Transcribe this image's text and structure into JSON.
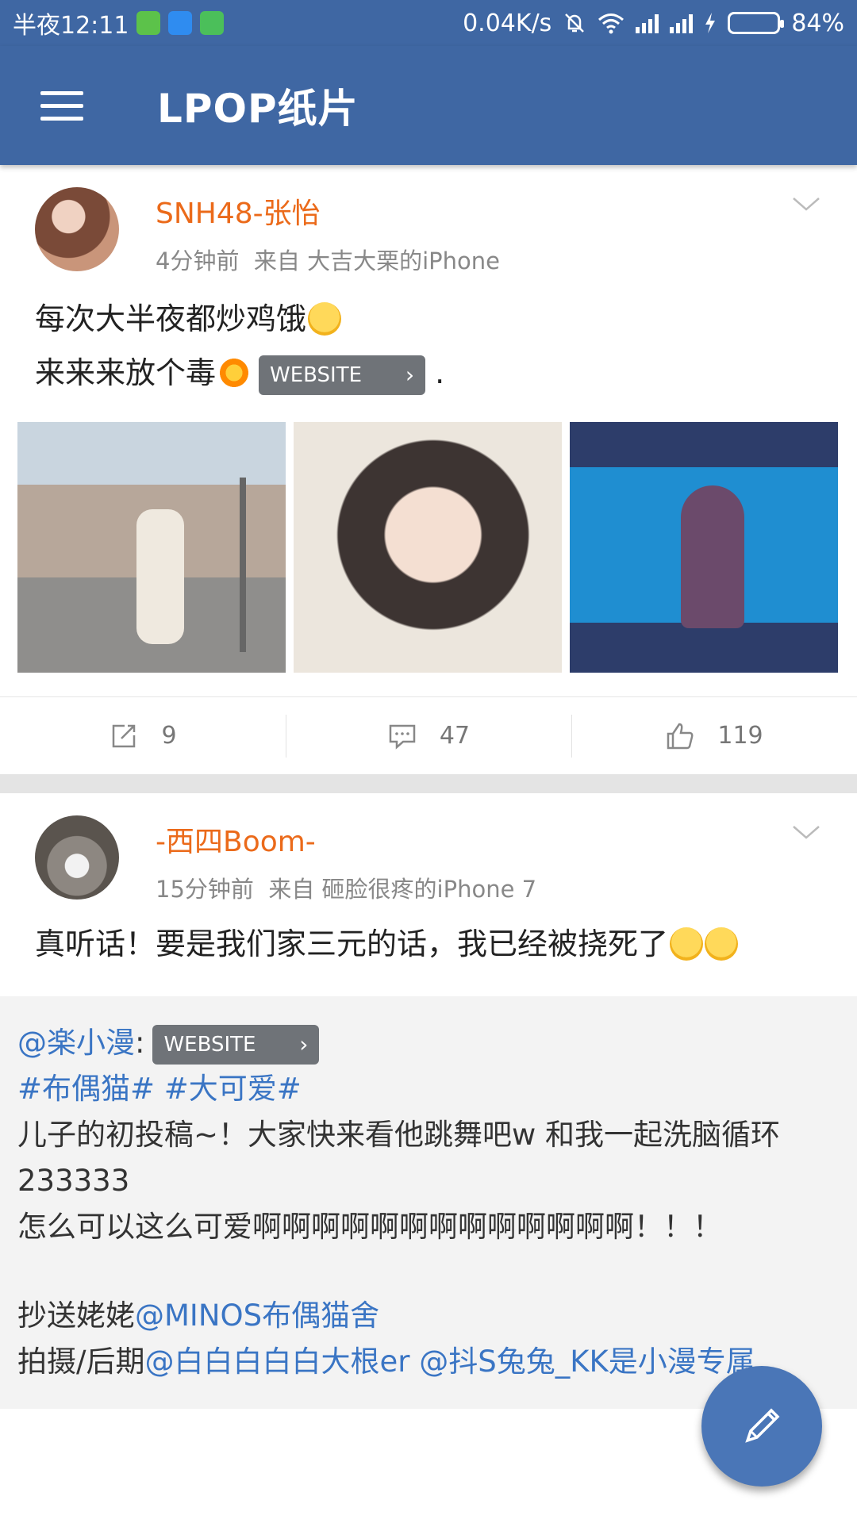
{
  "status_bar": {
    "time": "半夜12:11",
    "net_speed": "0.04K/s",
    "battery": "84%",
    "battery_level": 0.84
  },
  "app_bar": {
    "title": "LPOP纸片",
    "menu_icon": "hamburger-menu-icon"
  },
  "posts": [
    {
      "username": "SNH48-张怡",
      "time_ago": "4分钟前",
      "source": "来自 大吉大栗的iPhone",
      "text_line1": "每次大半夜都炒鸡饿",
      "text_line2": "来来来放个毒",
      "link_label": "WEBSITE",
      "text_tail": ".",
      "images": [
        "photo-1",
        "photo-2",
        "photo-3"
      ],
      "reposts": "9",
      "comments": "47",
      "likes": "119"
    },
    {
      "username": "-西四Boom-",
      "time_ago": "15分钟前",
      "source": "来自 砸脸很疼的iPhone 7",
      "text": "真听话！要是我们家三元的话，我已经被挠死了",
      "repost": {
        "author": "@楽小漫",
        "colon": ":",
        "link_label": "WEBSITE",
        "tag1": "#布偶猫#",
        "tag2": "#大可爱#",
        "line1": "儿子的初投稿~！大家快来看他跳舞吧w 和我一起洗脑循环233333",
        "line2": "怎么可以这么可爱啊啊啊啊啊啊啊啊啊啊啊啊啊！！！",
        "cc_prefix": "抄送姥姥",
        "cc_mention": "@MINOS布偶猫舍",
        "credit_prefix": "拍摄/后期",
        "credit_mention1": "@白白白白白大根er",
        "credit_mention2": "@抖S兔兔_KK是小漫专属"
      }
    }
  ],
  "colors": {
    "primary": "#3f67a3",
    "username": "#eb6a1a",
    "link": "#3a75c4"
  }
}
